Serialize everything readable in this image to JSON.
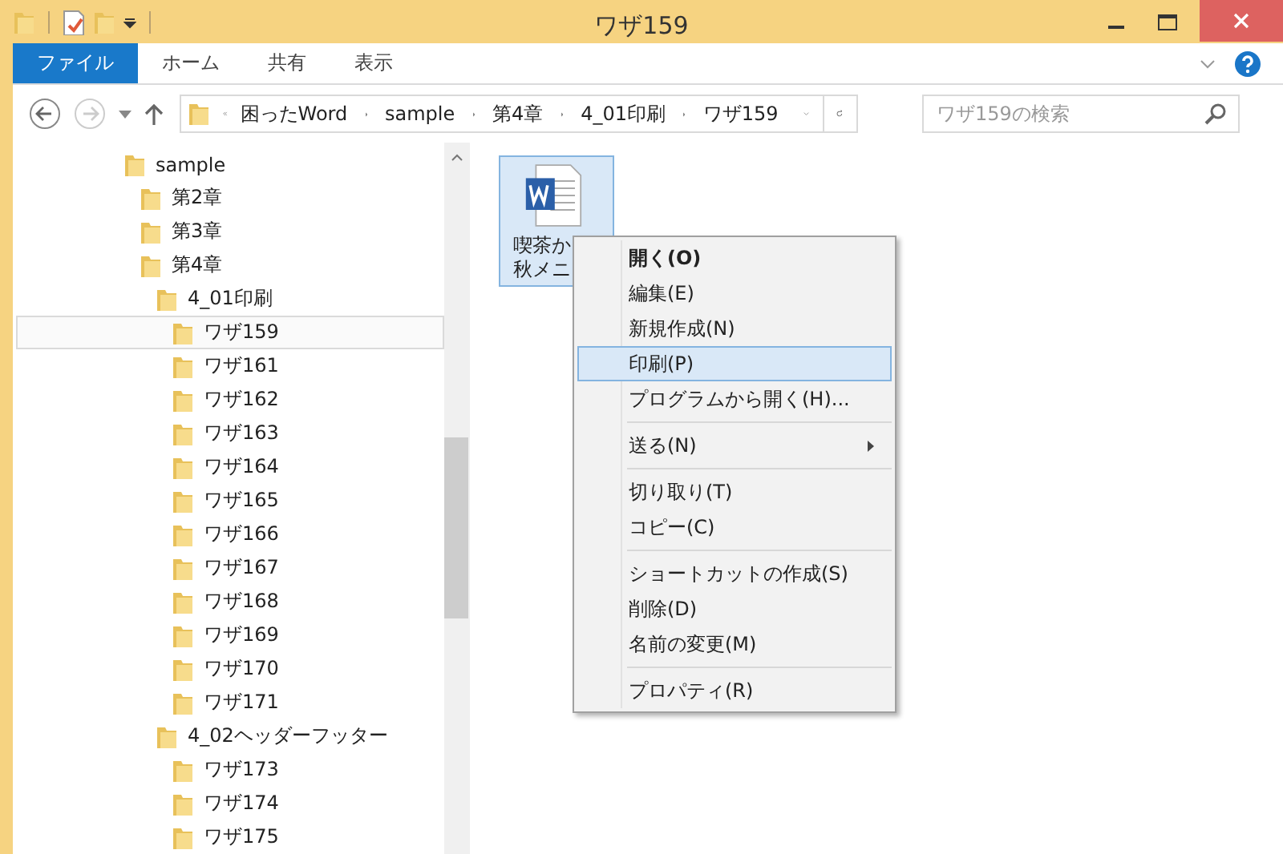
{
  "window": {
    "title": "ワザ159"
  },
  "ribbon": {
    "tabs": [
      {
        "label": "ファイル",
        "selected": true
      },
      {
        "label": "ホーム",
        "selected": false
      },
      {
        "label": "共有",
        "selected": false
      },
      {
        "label": "表示",
        "selected": false
      }
    ]
  },
  "address": {
    "segments": [
      "困ったWord",
      "sample",
      "第4章",
      "4_01印刷",
      "ワザ159"
    ]
  },
  "search": {
    "placeholder": "ワザ159の検索"
  },
  "tree": [
    {
      "label": "sample",
      "selected": false,
      "children": [
        {
          "label": "第2章",
          "selected": false
        },
        {
          "label": "第3章",
          "selected": false
        },
        {
          "label": "第4章",
          "selected": false,
          "children": [
            {
              "label": "4_01印刷",
              "selected": false,
              "children": [
                {
                  "label": "ワザ159",
                  "selected": true
                },
                {
                  "label": "ワザ161",
                  "selected": false
                },
                {
                  "label": "ワザ162",
                  "selected": false
                },
                {
                  "label": "ワザ163",
                  "selected": false
                },
                {
                  "label": "ワザ164",
                  "selected": false
                },
                {
                  "label": "ワザ165",
                  "selected": false
                },
                {
                  "label": "ワザ166",
                  "selected": false
                },
                {
                  "label": "ワザ167",
                  "selected": false
                },
                {
                  "label": "ワザ168",
                  "selected": false
                },
                {
                  "label": "ワザ169",
                  "selected": false
                },
                {
                  "label": "ワザ170",
                  "selected": false
                },
                {
                  "label": "ワザ171",
                  "selected": false
                }
              ]
            },
            {
              "label": "4_02ヘッダーフッター",
              "selected": false,
              "children": [
                {
                  "label": "ワザ173",
                  "selected": false
                },
                {
                  "label": "ワザ174",
                  "selected": false
                },
                {
                  "label": "ワザ175",
                  "selected": false
                }
              ]
            }
          ]
        }
      ]
    }
  ],
  "file": {
    "lines": [
      "喫茶か",
      "秋メニ"
    ],
    "selected": true
  },
  "context_menu": [
    {
      "kind": "item",
      "label": "開く(O)",
      "default": true,
      "submenu": false,
      "selected": false
    },
    {
      "kind": "item",
      "label": "編集(E)",
      "default": false,
      "submenu": false,
      "selected": false
    },
    {
      "kind": "item",
      "label": "新規作成(N)",
      "default": false,
      "submenu": false,
      "selected": false
    },
    {
      "kind": "item",
      "label": "印刷(P)",
      "default": false,
      "submenu": false,
      "selected": true
    },
    {
      "kind": "item",
      "label": "プログラムから開く(H)...",
      "default": false,
      "submenu": false,
      "selected": false
    },
    {
      "kind": "separator"
    },
    {
      "kind": "item",
      "label": "送る(N)",
      "default": false,
      "submenu": true,
      "selected": false
    },
    {
      "kind": "separator"
    },
    {
      "kind": "item",
      "label": "切り取り(T)",
      "default": false,
      "submenu": false,
      "selected": false
    },
    {
      "kind": "item",
      "label": "コピー(C)",
      "default": false,
      "submenu": false,
      "selected": false
    },
    {
      "kind": "separator"
    },
    {
      "kind": "item",
      "label": "ショートカットの作成(S)",
      "default": false,
      "submenu": false,
      "selected": false
    },
    {
      "kind": "item",
      "label": "削除(D)",
      "default": false,
      "submenu": false,
      "selected": false
    },
    {
      "kind": "item",
      "label": "名前の変更(M)",
      "default": false,
      "submenu": false,
      "selected": false
    },
    {
      "kind": "separator"
    },
    {
      "kind": "item",
      "label": "プロパティ(R)",
      "default": false,
      "submenu": false,
      "selected": false
    }
  ]
}
